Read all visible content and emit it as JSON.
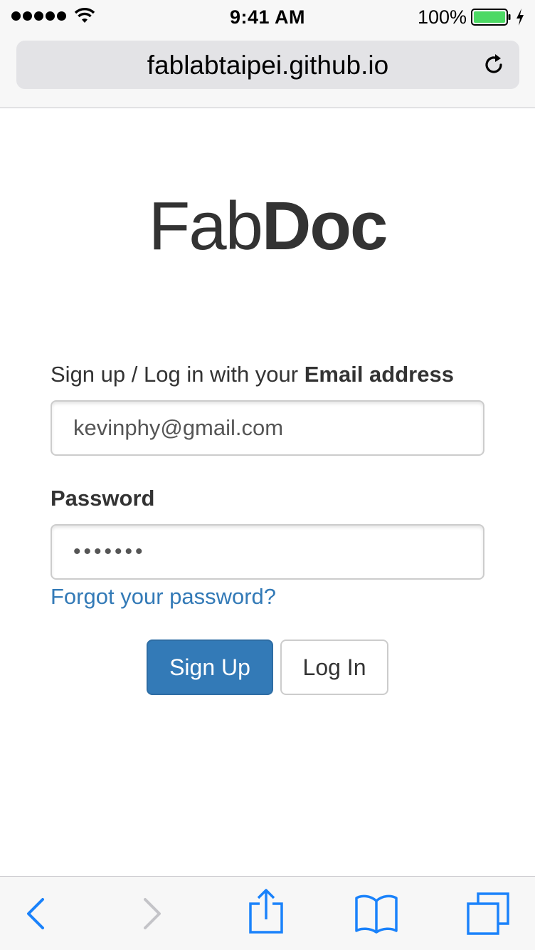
{
  "status_bar": {
    "time": "9:41 AM",
    "battery_percent": "100%",
    "signal_icon": "signal-dots-icon",
    "wifi_icon": "wifi-icon",
    "battery_icon": "battery-full-icon",
    "charging_icon": "charging-bolt-icon",
    "battery_color": "#4cd964"
  },
  "browser": {
    "url": "fablabtaipei.github.io",
    "reload_icon": "reload-icon"
  },
  "page": {
    "logo_light": "Fab",
    "logo_bold": "Doc",
    "email_label_prefix": "Sign up / Log in with your ",
    "email_label_bold": "Email address",
    "email_value": "kevinphy@gmail.com",
    "password_label": "Password",
    "password_value": "•••••••",
    "forgot_link": "Forgot your password?",
    "signup_button": "Sign Up",
    "login_button": "Log In",
    "link_color": "#337ab7",
    "primary_color": "#337ab7"
  },
  "toolbar": {
    "icons": [
      "back-icon",
      "forward-icon",
      "share-icon",
      "bookmarks-icon",
      "tabs-icon"
    ],
    "accent": "#1a82fb"
  }
}
